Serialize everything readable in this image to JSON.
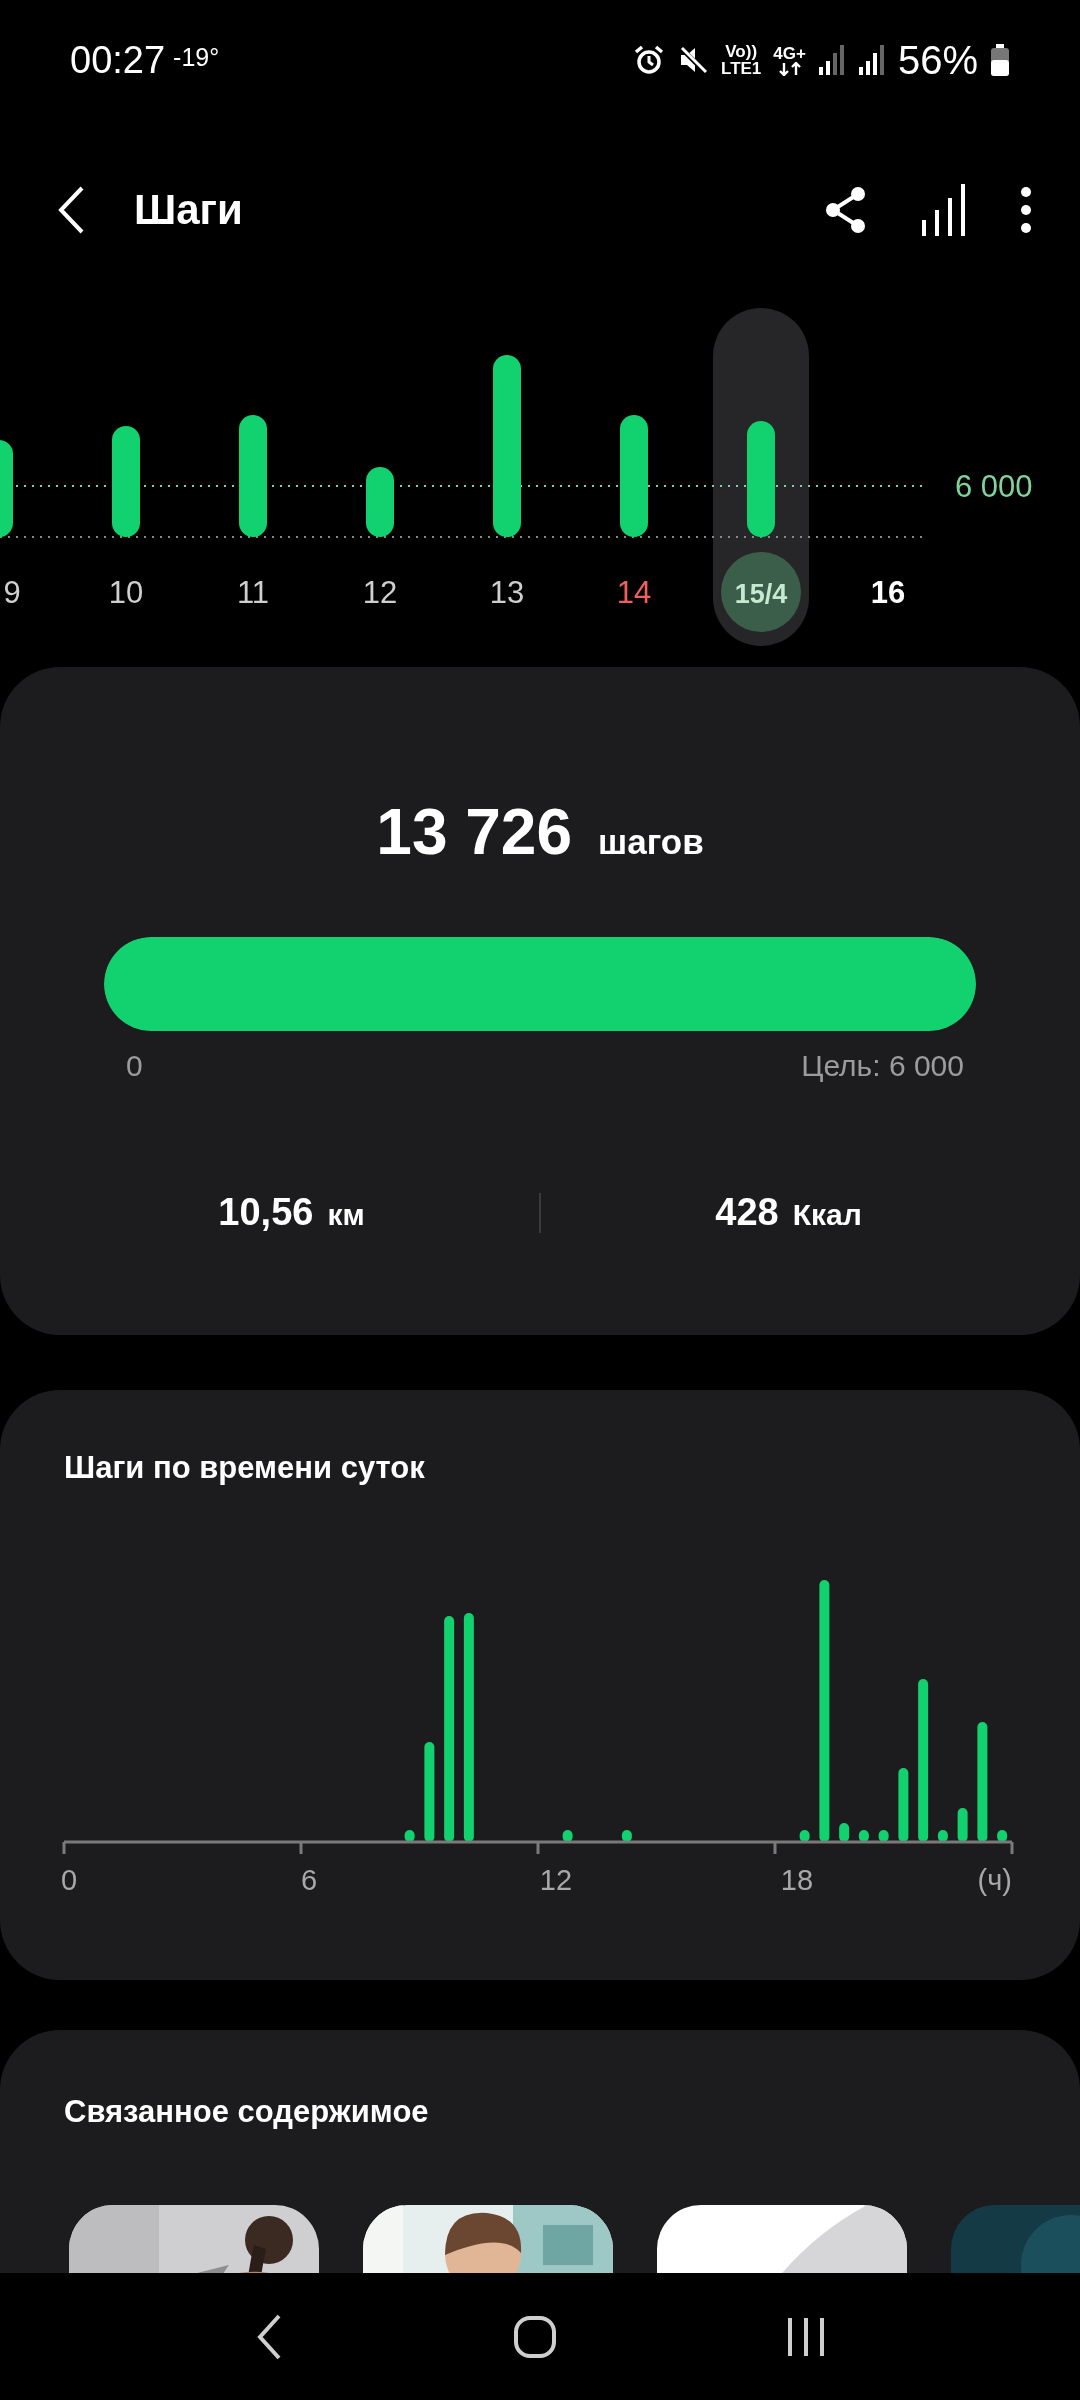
{
  "status_bar": {
    "time": "00:27",
    "temperature": "-19°",
    "volte": "Vo))",
    "lte": "LTE1",
    "network": "4G+",
    "battery_percent": "56%"
  },
  "header": {
    "title": "Шаги"
  },
  "days_chart": {
    "goal_label": "6 000",
    "days": [
      {
        "label": "9",
        "selected": false,
        "kind": "normal"
      },
      {
        "label": "10",
        "selected": false,
        "kind": "normal"
      },
      {
        "label": "11",
        "selected": false,
        "kind": "normal"
      },
      {
        "label": "12",
        "selected": false,
        "kind": "normal"
      },
      {
        "label": "13",
        "selected": false,
        "kind": "normal"
      },
      {
        "label": "14",
        "selected": false,
        "kind": "holiday"
      },
      {
        "label": "15/4",
        "selected": true,
        "kind": "normal"
      },
      {
        "label": "16",
        "selected": false,
        "kind": "today"
      }
    ]
  },
  "summary": {
    "steps": "13 726",
    "steps_unit": "шагов",
    "progress": {
      "level": 1,
      "start_label": "0",
      "goal_label": "Цель: 6 000"
    },
    "distance": "10,56",
    "distance_unit": "км",
    "calories": "428",
    "calories_unit": "Ккал"
  },
  "hourly": {
    "title": "Шаги по времени суток",
    "axis_labels": [
      "0",
      "6",
      "12",
      "18",
      "(ч)"
    ]
  },
  "related": {
    "title": "Связанное содержимое"
  }
}
